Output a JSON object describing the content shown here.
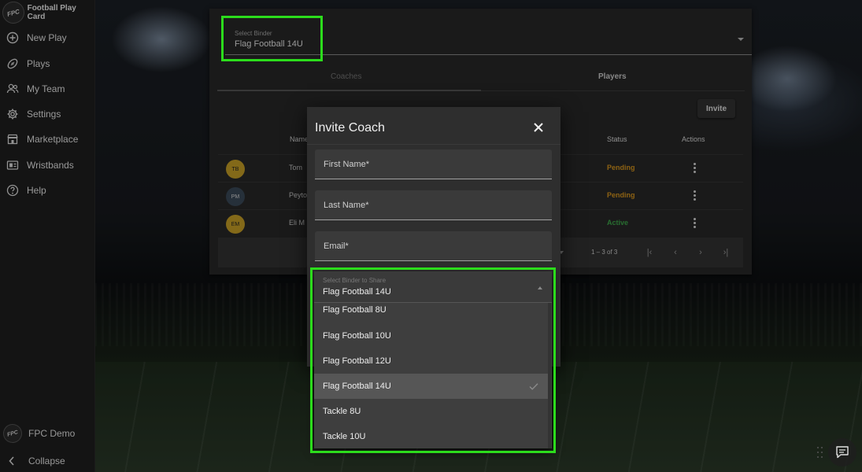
{
  "app": {
    "title": "Football Play Card",
    "logo_text": "FPC"
  },
  "sidebar": {
    "items": [
      {
        "label": "New Play",
        "icon": "plus-circle-icon"
      },
      {
        "label": "Plays",
        "icon": "football-icon"
      },
      {
        "label": "My Team",
        "icon": "team-icon"
      },
      {
        "label": "Settings",
        "icon": "gear-icon"
      },
      {
        "label": "Marketplace",
        "icon": "storefront-icon"
      },
      {
        "label": "Wristbands",
        "icon": "wristband-icon"
      },
      {
        "label": "Help",
        "icon": "help-circle-icon"
      }
    ],
    "user_name": "FPC Demo",
    "user_logo_text": "FPC",
    "collapse_label": "Collapse"
  },
  "binder_select": {
    "label": "Select Binder",
    "value": "Flag Football 14U"
  },
  "tabs": {
    "coaches_label": "Coaches",
    "players_label": "Players"
  },
  "toolbar": {
    "invite_label": "Invite"
  },
  "table": {
    "headers": {
      "name": "Name",
      "status": "Status",
      "actions": "Actions"
    },
    "rows": [
      {
        "initials": "TB",
        "name": "Tom",
        "status": "Pending",
        "avatar_color": "#c9a227",
        "status_color": "#d9971e"
      },
      {
        "initials": "PM",
        "name": "Peyto",
        "status": "Pending",
        "avatar_color": "#3b4a5a",
        "status_color": "#d9971e"
      },
      {
        "initials": "EM",
        "name": "Eli M",
        "status": "Active",
        "avatar_color": "#c9a227",
        "status_color": "#3ea84a"
      }
    ]
  },
  "pagination": {
    "range": "1 – 3 of 3"
  },
  "modal": {
    "title": "Invite Coach",
    "first_name_placeholder": "First Name*",
    "last_name_placeholder": "Last Name*",
    "email_placeholder": "Email*",
    "binder_label": "Select Binder to Share",
    "binder_value": "Flag Football 14U",
    "binder_options": [
      {
        "label": "Flag Football 8U",
        "selected": false
      },
      {
        "label": "Flag Football 10U",
        "selected": false
      },
      {
        "label": "Flag Football 12U",
        "selected": false
      },
      {
        "label": "Flag Football 14U",
        "selected": true
      },
      {
        "label": "Tackle 8U",
        "selected": false
      },
      {
        "label": "Tackle 10U",
        "selected": false
      }
    ]
  },
  "colors": {
    "highlight": "#2cdc1c",
    "pending": "#d9971e",
    "active": "#3ea84a",
    "sidebar_bg": "#1f1f1f",
    "panel_bg": "#292929"
  }
}
